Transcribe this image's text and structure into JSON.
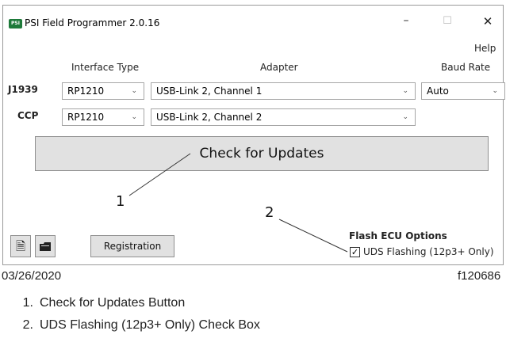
{
  "window": {
    "app_icon": "psi-logo-icon",
    "app_icon_text": "PSI",
    "title": "PSI Field Programmer 2.0.16",
    "minimize": "–",
    "maximize": "☐",
    "close": "✕",
    "menu_help": "Help"
  },
  "headers": {
    "interface_type": "Interface Type",
    "adapter": "Adapter",
    "baud_rate": "Baud Rate"
  },
  "rows": [
    {
      "label": "J1939",
      "interface": "RP1210",
      "adapter": "USB-Link 2, Channel 1",
      "baud": "Auto"
    },
    {
      "label": "CCP",
      "interface": "RP1210",
      "adapter": "USB-Link 2, Channel 2"
    }
  ],
  "check_updates_label": "Check for Updates",
  "toolbar": {
    "doc_icon": "document-flag-icon",
    "folder_icon": "folder-icon",
    "registration_label": "Registration"
  },
  "flash_options": {
    "heading": "Flash ECU Options",
    "uds_label": "UDS Flashing (12p3+ Only)",
    "uds_checked": true
  },
  "figure": {
    "callout_1": "1",
    "callout_2": "2",
    "date": "03/26/2020",
    "fig_id": "f120686",
    "legend": [
      {
        "num": "1.",
        "text": "Check for Updates Button"
      },
      {
        "num": "2.",
        "text": "UDS Flashing (12p3+ Only) Check Box"
      }
    ]
  }
}
